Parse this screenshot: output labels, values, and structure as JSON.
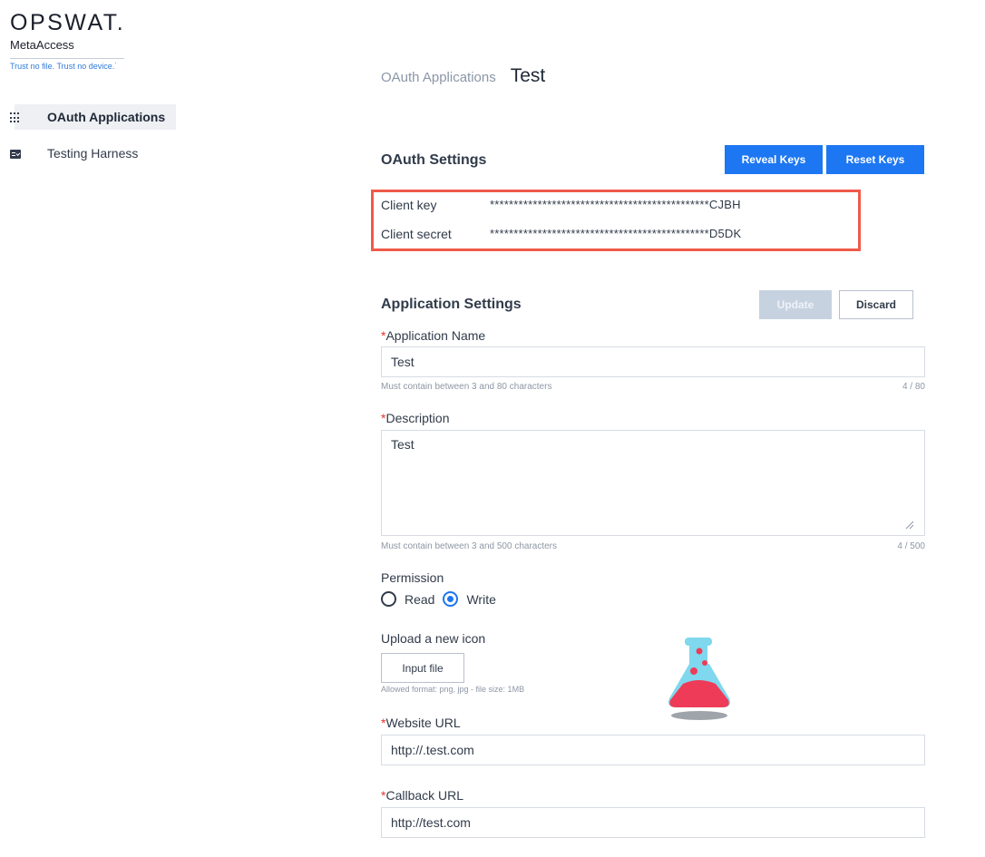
{
  "logo": {
    "brand": "OPSWAT.",
    "product": "MetaAccess",
    "tagline": "Trust no file. Trust no device.˙"
  },
  "sidebar": {
    "items": [
      {
        "label": "OAuth Applications",
        "icon": "grid-icon",
        "active": true
      },
      {
        "label": "Testing Harness",
        "icon": "task-icon",
        "active": false
      }
    ]
  },
  "breadcrumb": {
    "parent": "OAuth Applications",
    "current": "Test"
  },
  "oauth_settings": {
    "title": "OAuth Settings",
    "reveal_label": "Reveal Keys",
    "reset_label": "Reset Keys",
    "client_key_label": "Client key",
    "client_key_value": "**********************************************CJBH",
    "client_secret_label": "Client secret",
    "client_secret_value": "**********************************************D5DK",
    "highlight_color": "#f05a4a"
  },
  "application_settings": {
    "title": "Application Settings",
    "update_label": "Update",
    "discard_label": "Discard",
    "required_mark": "*",
    "name": {
      "label": "Application Name",
      "value": "Test",
      "hint": "Must contain between 3 and 80 characters",
      "counter": "4 / 80"
    },
    "description": {
      "label": "Description",
      "value": "Test",
      "hint": "Must contain between 3 and 500 characters",
      "counter": "4 / 500"
    },
    "permission": {
      "label": "Permission",
      "options": [
        {
          "label": "Read",
          "checked": false
        },
        {
          "label": "Write",
          "checked": true
        }
      ]
    },
    "icon_upload": {
      "label": "Upload a new icon",
      "button_label": "Input file",
      "hint": "Allowed format: png, jpg - file size: 1MB",
      "preview_icon": "flask-icon"
    },
    "website": {
      "label": "Website URL",
      "value": "http://.test.com"
    },
    "callback": {
      "label": "Callback URL",
      "value": "http://test.com"
    }
  },
  "colors": {
    "primary": "#1d77f2",
    "required": "#e5342a",
    "text": "#313b4a"
  }
}
